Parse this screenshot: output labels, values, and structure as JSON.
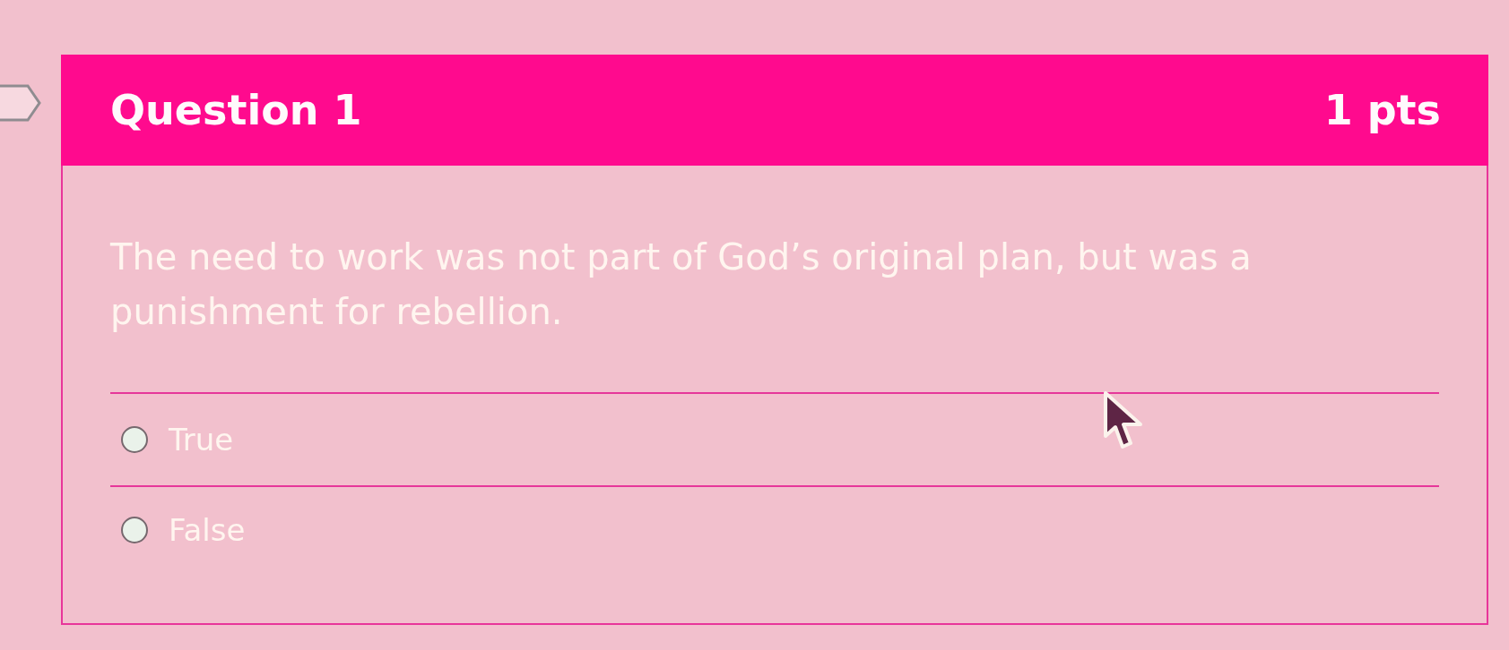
{
  "question": {
    "title": "Question 1",
    "points": "1 pts",
    "text": "The need to work was not part of God’s original plan, but was a punishment for rebellion.",
    "options": [
      {
        "label": "True",
        "selected": false
      },
      {
        "label": "False",
        "selected": false
      }
    ]
  }
}
